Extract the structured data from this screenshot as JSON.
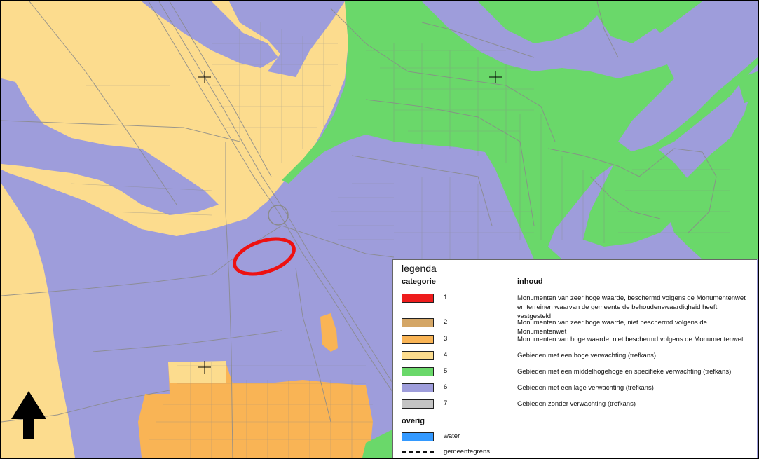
{
  "map": {
    "colors": {
      "category6_purple": "#9e9ddb",
      "category4_yellow": "#fcdc8e",
      "category5_green": "#6ad86a",
      "category3_orange": "#f9b455",
      "road_gray": "#8a8a8a",
      "highlight_red": "#ee1111"
    },
    "icons": [
      "crosshair-icon",
      "north-arrow-icon"
    ]
  },
  "legend": {
    "title": "legenda",
    "category_header": "categorie",
    "content_header": "inhoud",
    "categories": [
      {
        "num": "1",
        "color": "#ee1c1c",
        "text": "Monumenten van zeer hoge waarde, beschermd volgens de Monumentenwet en terreinen waarvan de gemeente de behoudenswaardigheid heeft vastgesteld"
      },
      {
        "num": "2",
        "color": "#d4a666",
        "text": "Monumenten van zeer hoge waarde, niet beschermd volgens de Monumentenwet"
      },
      {
        "num": "3",
        "color": "#f9b455",
        "text": "Monumenten van hoge waarde, niet beschermd volgens de Monumentenwet"
      },
      {
        "num": "4",
        "color": "#fcdc8e",
        "text": "Gebieden met een hoge verwachting (trefkans)"
      },
      {
        "num": "5",
        "color": "#6ad86a",
        "text": "Gebieden met een middelhogehoge en specifieke verwachting (trefkans)"
      },
      {
        "num": "6",
        "color": "#9e9ddb",
        "text": "Gebieden met een lage verwachting (trefkans)"
      },
      {
        "num": "7",
        "color": "#c4c4c4",
        "text": "Gebieden zonder verwachting (trefkans)"
      }
    ],
    "other_header": "overig",
    "other": [
      {
        "type": "swatch",
        "color": "#3399ff",
        "text": "water"
      },
      {
        "type": "line",
        "text": "gemeentegrens"
      }
    ]
  }
}
